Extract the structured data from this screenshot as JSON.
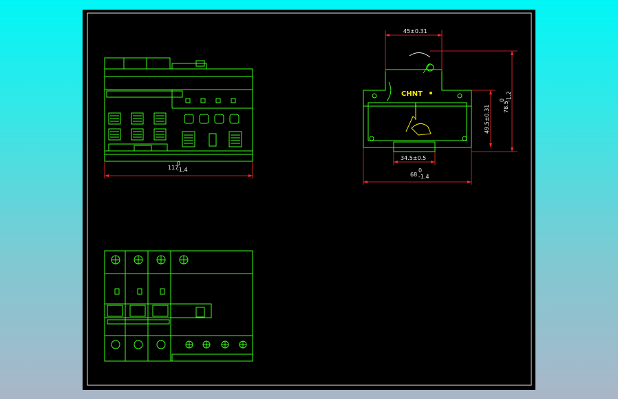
{
  "drawing": {
    "views": [
      "front-view",
      "side-view",
      "top-view"
    ],
    "brand_logo": "CHNT",
    "colors": {
      "background_outer": "#00f6f6",
      "paper": "#000000",
      "outline": "#39ff14",
      "dimension_line": "#ff2b2b",
      "dimension_text": "#f2f2f2",
      "logo": "#f4e600",
      "frame": "#ffffff"
    }
  },
  "dimensions": {
    "front_width": {
      "nominal": "117",
      "upper": "0",
      "lower": "-1.4"
    },
    "side_top_width": "45±0.31",
    "side_total_height": {
      "nominal": "78.5",
      "upper": "0",
      "lower": "-1.2"
    },
    "side_body_height": "49.5±0.31",
    "side_rail_width": "34.5±0.5",
    "side_depth": {
      "nominal": "68",
      "upper": "0",
      "lower": "-1.4"
    }
  }
}
